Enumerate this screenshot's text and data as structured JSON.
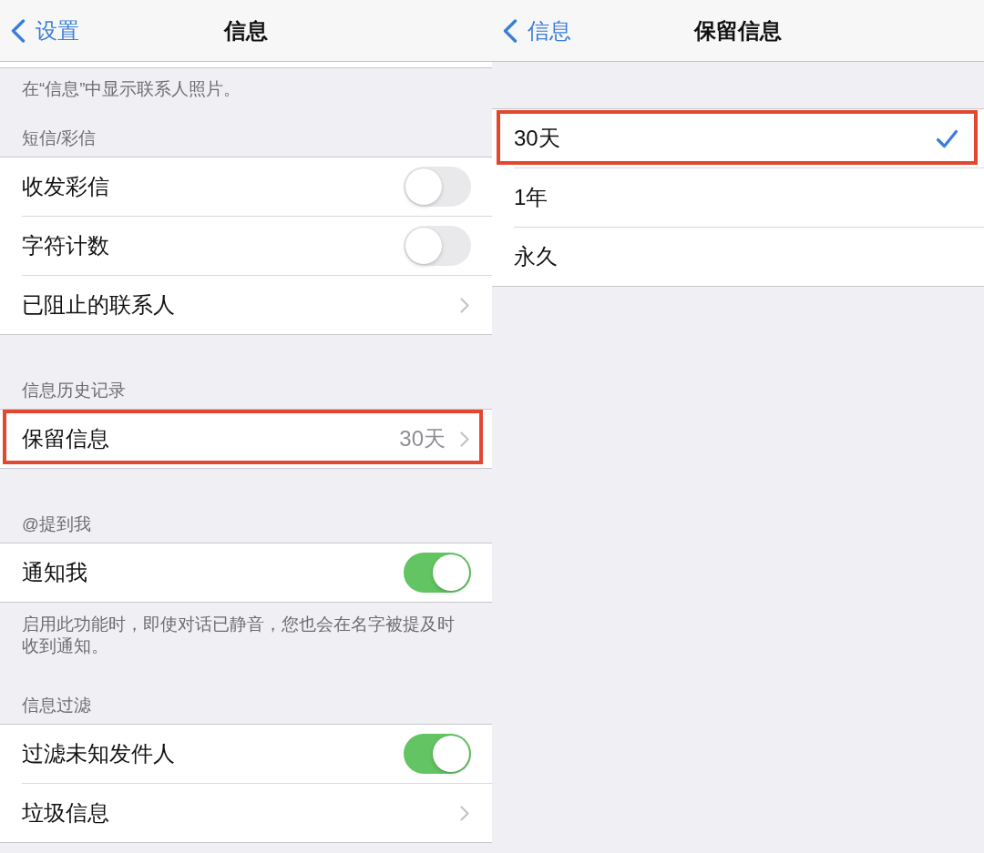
{
  "settings_page": {
    "nav_bar": {
      "back_label": "设置",
      "title": "信息"
    },
    "note": "在“信息”中显示联系人照片。",
    "sections": [
      {
        "header": "短信/彩信",
        "rows": [
          {
            "kind": "toggle",
            "label": "收发彩信",
            "on": false,
            "highlighted": false
          },
          {
            "kind": "toggle",
            "label": "字符计数",
            "on": false,
            "highlighted": false
          },
          {
            "kind": "link",
            "label": "已阻止的联系人",
            "highlighted": false
          }
        ]
      },
      {
        "header": "信息历史记录",
        "rows": [
          {
            "kind": "link",
            "label": "保留信息",
            "value": "30天",
            "highlighted": true
          }
        ]
      },
      {
        "header": "@提到我",
        "rows": [
          {
            "kind": "toggle",
            "label": "通知我",
            "on": true,
            "highlighted": false
          }
        ],
        "footer": "启用此功能时，即使对话已静音，您也会在名字被提及时收到通知。"
      },
      {
        "header": "信息过滤",
        "rows": [
          {
            "kind": "toggle",
            "label": "过滤未知发件人",
            "on": true,
            "highlighted": false
          },
          {
            "kind": "link",
            "label": "垃圾信息",
            "highlighted": false
          }
        ]
      }
    ]
  },
  "retention_page": {
    "nav_bar": {
      "back_label": "信息",
      "title": "保留信息"
    },
    "options": [
      {
        "label": "30天",
        "selected": true,
        "highlighted": true
      },
      {
        "label": "1年",
        "selected": false,
        "highlighted": false
      },
      {
        "label": "永久",
        "selected": false,
        "highlighted": false
      }
    ]
  }
}
